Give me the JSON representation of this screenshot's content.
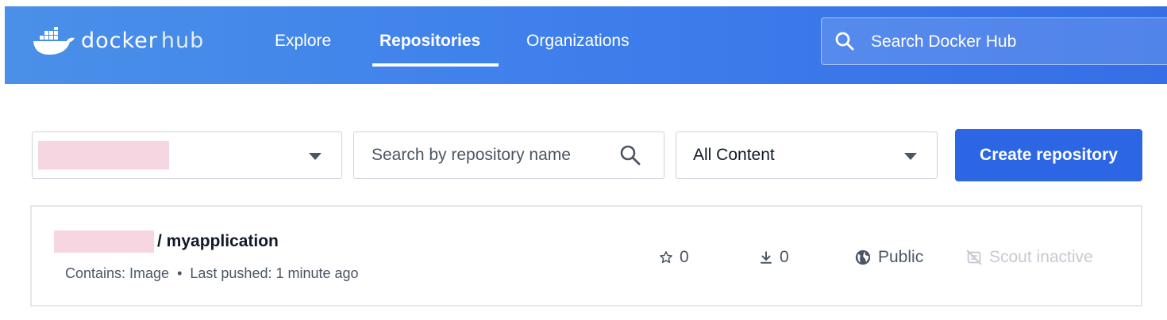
{
  "header": {
    "brand": {
      "word1": "docker",
      "word2": "hub"
    },
    "nav": [
      {
        "label": "Explore",
        "active": false
      },
      {
        "label": "Repositories",
        "active": true
      },
      {
        "label": "Organizations",
        "active": false
      }
    ],
    "search": {
      "placeholder": "Search Docker Hub",
      "icon": "search-icon"
    }
  },
  "toolbar": {
    "namespace_select": {
      "value": "",
      "redacted": true,
      "icon": "chevron-down-icon"
    },
    "repo_search": {
      "placeholder": "Search by repository name",
      "icon": "search-icon"
    },
    "content_filter": {
      "value": "All Content",
      "icon": "chevron-down-icon"
    },
    "create_label": "Create repository"
  },
  "repositories": [
    {
      "owner_redacted": true,
      "name": "/ myapplication",
      "contains_label": "Contains: Image",
      "separator": "•",
      "last_pushed": "Last pushed: 1 minute ago",
      "stars": "0",
      "pulls": "0",
      "visibility": "Public",
      "scout": "Scout inactive"
    }
  ],
  "colors": {
    "header_gradient_start": "#4a90e8",
    "header_gradient_end": "#356fe6",
    "primary_button": "#2c66e4",
    "redaction": "#f6d6e0",
    "muted_text": "#c5cad1"
  }
}
